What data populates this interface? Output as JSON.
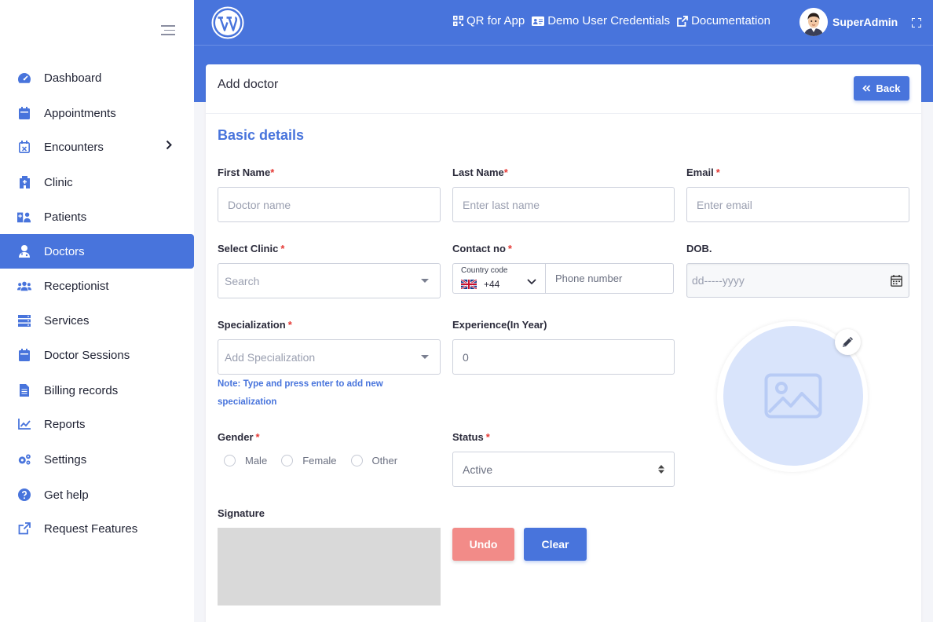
{
  "sidebar": {
    "items": [
      {
        "label": "Dashboard",
        "icon": "dashboard-gauge-icon"
      },
      {
        "label": "Appointments",
        "icon": "calendar-icon"
      },
      {
        "label": "Encounters",
        "icon": "calendar-x-icon"
      },
      {
        "label": "Clinic",
        "icon": "hospital-icon"
      },
      {
        "label": "Patients",
        "icon": "patients-icon"
      },
      {
        "label": "Doctors",
        "icon": "doctor-icon"
      },
      {
        "label": "Receptionist",
        "icon": "users-icon"
      },
      {
        "label": "Services",
        "icon": "server-icon"
      },
      {
        "label": "Doctor Sessions",
        "icon": "calendar-icon"
      },
      {
        "label": "Billing records",
        "icon": "file-icon"
      },
      {
        "label": "Reports",
        "icon": "chart-line-icon"
      },
      {
        "label": "Settings",
        "icon": "gears-icon"
      },
      {
        "label": "Get help",
        "icon": "question-circle-icon"
      },
      {
        "label": "Request Features",
        "icon": "external-link-icon"
      }
    ],
    "active": "Doctors"
  },
  "topbar": {
    "qr_label": "QR for App",
    "demo_label": "Demo User Credentials",
    "docs_label": "Documentation",
    "username": "SuperAdmin"
  },
  "card": {
    "title": "Add doctor",
    "back_label": "Back",
    "section_title": "Basic details"
  },
  "form": {
    "first_name": {
      "label": "First Name",
      "placeholder": "Doctor name"
    },
    "last_name": {
      "label": "Last Name",
      "placeholder": "Enter last name"
    },
    "email": {
      "label": "Email",
      "placeholder": "Enter email"
    },
    "clinic": {
      "label": "Select Clinic",
      "placeholder": "Search"
    },
    "contact": {
      "label": "Contact no",
      "country_code_label": "Country code",
      "country_code_value": "+44",
      "placeholder": "Phone number"
    },
    "dob": {
      "label": "DOB.",
      "placeholder": "dd-----yyyy"
    },
    "specialization": {
      "label": "Specialization",
      "placeholder": "Add Specialization",
      "note": "Note: Type and press enter to add new specialization"
    },
    "experience": {
      "label": "Experience(In Year)",
      "value": "0"
    },
    "gender": {
      "label": "Gender",
      "options": [
        "Male",
        "Female",
        "Other"
      ]
    },
    "status": {
      "label": "Status",
      "value": "Active"
    },
    "signature": {
      "label": "Signature",
      "undo_label": "Undo",
      "clear_label": "Clear"
    }
  },
  "colors": {
    "primary": "#4874dc",
    "danger": "#e53935",
    "undo": "#f28b88"
  }
}
